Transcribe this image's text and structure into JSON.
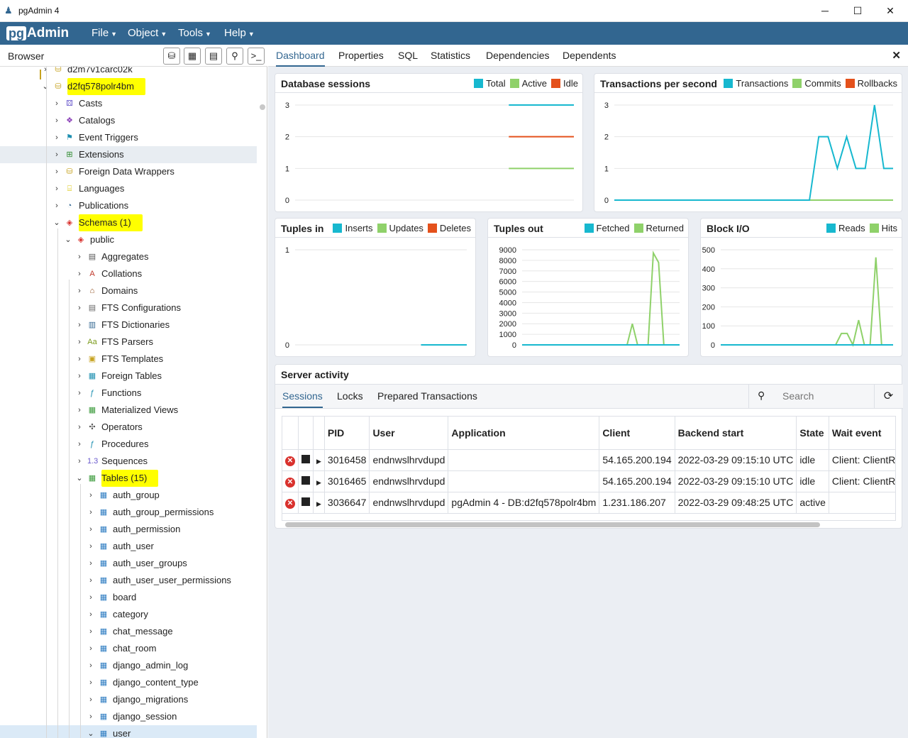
{
  "window": {
    "title": "pgAdmin 4",
    "minimize": "─",
    "maximize": "☐",
    "close": "✕"
  },
  "menubar": {
    "brand_pg": "pg",
    "brand_admin": "Admin",
    "items": [
      "File",
      "Object",
      "Tools",
      "Help"
    ]
  },
  "browser": {
    "label": "Browser",
    "toolbar_icons": [
      "database-icon",
      "grid-icon",
      "filter-table-icon",
      "search-icon",
      "terminal-icon"
    ]
  },
  "tree": [
    {
      "label": "d2m7v1carc02k",
      "depth": 0,
      "chev": "›",
      "icon": "db"
    },
    {
      "label": "d2fq578polr4bm",
      "depth": 0,
      "chev": "⌄",
      "icon": "db",
      "hl": true
    },
    {
      "label": "Casts",
      "depth": 1,
      "chev": "›",
      "icon": "cast"
    },
    {
      "label": "Catalogs",
      "depth": 1,
      "chev": "›",
      "icon": "catalog"
    },
    {
      "label": "Event Triggers",
      "depth": 1,
      "chev": "›",
      "icon": "trigger"
    },
    {
      "label": "Extensions",
      "depth": 1,
      "chev": "›",
      "icon": "ext",
      "sel": true
    },
    {
      "label": "Foreign Data Wrappers",
      "depth": 1,
      "chev": "›",
      "icon": "fdw"
    },
    {
      "label": "Languages",
      "depth": 1,
      "chev": "›",
      "icon": "lang"
    },
    {
      "label": "Publications",
      "depth": 1,
      "chev": "›",
      "icon": "pub"
    },
    {
      "label": "Schemas (1)",
      "depth": 1,
      "chev": "⌄",
      "icon": "schemas",
      "hl": true
    },
    {
      "label": "public",
      "depth": 2,
      "chev": "⌄",
      "icon": "schema"
    },
    {
      "label": "Aggregates",
      "depth": 3,
      "chev": "›",
      "icon": "agg"
    },
    {
      "label": "Collations",
      "depth": 3,
      "chev": "›",
      "icon": "coll"
    },
    {
      "label": "Domains",
      "depth": 3,
      "chev": "›",
      "icon": "domain"
    },
    {
      "label": "FTS Configurations",
      "depth": 3,
      "chev": "›",
      "icon": "fts"
    },
    {
      "label": "FTS Dictionaries",
      "depth": 3,
      "chev": "›",
      "icon": "ftsd"
    },
    {
      "label": "FTS Parsers",
      "depth": 3,
      "chev": "›",
      "icon": "ftsp"
    },
    {
      "label": "FTS Templates",
      "depth": 3,
      "chev": "›",
      "icon": "ftst"
    },
    {
      "label": "Foreign Tables",
      "depth": 3,
      "chev": "›",
      "icon": "ftable"
    },
    {
      "label": "Functions",
      "depth": 3,
      "chev": "›",
      "icon": "func"
    },
    {
      "label": "Materialized Views",
      "depth": 3,
      "chev": "›",
      "icon": "mview"
    },
    {
      "label": "Operators",
      "depth": 3,
      "chev": "›",
      "icon": "oper"
    },
    {
      "label": "Procedures",
      "depth": 3,
      "chev": "›",
      "icon": "proc"
    },
    {
      "label": "Sequences",
      "depth": 3,
      "chev": "›",
      "icon": "seq"
    },
    {
      "label": "Tables (15)",
      "depth": 3,
      "chev": "⌄",
      "icon": "tables",
      "hl": true
    },
    {
      "label": "auth_group",
      "depth": 4,
      "chev": "›",
      "icon": "table"
    },
    {
      "label": "auth_group_permissions",
      "depth": 4,
      "chev": "›",
      "icon": "table"
    },
    {
      "label": "auth_permission",
      "depth": 4,
      "chev": "›",
      "icon": "table"
    },
    {
      "label": "auth_user",
      "depth": 4,
      "chev": "›",
      "icon": "table"
    },
    {
      "label": "auth_user_groups",
      "depth": 4,
      "chev": "›",
      "icon": "table"
    },
    {
      "label": "auth_user_user_permissions",
      "depth": 4,
      "chev": "›",
      "icon": "table"
    },
    {
      "label": "board",
      "depth": 4,
      "chev": "›",
      "icon": "table"
    },
    {
      "label": "category",
      "depth": 4,
      "chev": "›",
      "icon": "table"
    },
    {
      "label": "chat_message",
      "depth": 4,
      "chev": "›",
      "icon": "table"
    },
    {
      "label": "chat_room",
      "depth": 4,
      "chev": "›",
      "icon": "table"
    },
    {
      "label": "django_admin_log",
      "depth": 4,
      "chev": "›",
      "icon": "table"
    },
    {
      "label": "django_content_type",
      "depth": 4,
      "chev": "›",
      "icon": "table"
    },
    {
      "label": "django_migrations",
      "depth": 4,
      "chev": "›",
      "icon": "table"
    },
    {
      "label": "django_session",
      "depth": 4,
      "chev": "›",
      "icon": "table"
    },
    {
      "label": "user",
      "depth": 4,
      "chev": "⌄",
      "icon": "table",
      "sel2": true
    }
  ],
  "tabs": {
    "items": [
      "Dashboard",
      "Properties",
      "SQL",
      "Statistics",
      "Dependencies",
      "Dependents"
    ],
    "active": "Dashboard",
    "close": "✕"
  },
  "colors": {
    "blue": "#17b8cf",
    "green": "#8fd16a",
    "red": "#e4511c",
    "brand": "#326690"
  },
  "chart_data": [
    {
      "type": "line",
      "title": "Database sessions",
      "yticks": [
        "3",
        "2",
        "1",
        "0"
      ],
      "ylim": [
        0,
        3
      ],
      "series": [
        {
          "name": "Total",
          "color": "#17b8cf",
          "x": [
            23,
            30
          ],
          "y": [
            3,
            3
          ]
        },
        {
          "name": "Active",
          "color": "#8fd16a",
          "x": [
            23,
            30
          ],
          "y": [
            1,
            1
          ]
        },
        {
          "name": "Idle",
          "color": "#e4511c",
          "x": [
            23,
            30
          ],
          "y": [
            2,
            2
          ]
        }
      ],
      "xlim": [
        0,
        30
      ]
    },
    {
      "type": "line",
      "title": "Transactions per second",
      "yticks": [
        "3",
        "2",
        "1",
        "0"
      ],
      "ylim": [
        0,
        3
      ],
      "series": [
        {
          "name": "Transactions",
          "color": "#17b8cf",
          "x": [
            0,
            1,
            2,
            3,
            4,
            5,
            6,
            7,
            8,
            9,
            10,
            11,
            12,
            13,
            14,
            15,
            16,
            17,
            18,
            19,
            20,
            21,
            22,
            23,
            24,
            25,
            26,
            27,
            28,
            29,
            30
          ],
          "y": [
            0,
            0,
            0,
            0,
            0,
            0,
            0,
            0,
            0,
            0,
            0,
            0,
            0,
            0,
            0,
            0,
            0,
            0,
            0,
            0,
            0,
            0,
            2,
            2,
            1,
            2,
            1,
            1,
            3,
            1,
            1
          ]
        },
        {
          "name": "Commits",
          "color": "#8fd16a",
          "x": [
            0,
            30
          ],
          "y": [
            0,
            0
          ]
        },
        {
          "name": "Rollbacks",
          "color": "#e4511c",
          "x": [
            0,
            30
          ],
          "y": [
            0,
            0
          ]
        }
      ],
      "xlim": [
        0,
        30
      ]
    },
    {
      "type": "line",
      "title": "Tuples in",
      "yticks": [
        "1",
        "0"
      ],
      "ylim": [
        0,
        1
      ],
      "series": [
        {
          "name": "Inserts",
          "color": "#17b8cf",
          "x": [
            22,
            30
          ],
          "y": [
            0,
            0
          ]
        },
        {
          "name": "Updates",
          "color": "#8fd16a",
          "x": [],
          "y": []
        },
        {
          "name": "Deletes",
          "color": "#e4511c",
          "x": [],
          "y": []
        }
      ],
      "xlim": [
        0,
        30
      ]
    },
    {
      "type": "line",
      "title": "Tuples out",
      "yticks": [
        "9000",
        "8000",
        "7000",
        "6000",
        "5000",
        "4000",
        "3000",
        "2000",
        "1000",
        "0"
      ],
      "ylim": [
        0,
        9000
      ],
      "series": [
        {
          "name": "Fetched",
          "color": "#17b8cf",
          "x": [
            0,
            30
          ],
          "y": [
            0,
            0
          ]
        },
        {
          "name": "Returned",
          "color": "#8fd16a",
          "x": [
            0,
            10,
            11,
            12,
            20,
            21,
            22,
            23,
            24,
            25,
            26,
            27,
            28,
            29,
            30
          ],
          "y": [
            0,
            0,
            0,
            0,
            0,
            2000,
            0,
            0,
            0,
            8700,
            7800,
            0,
            0,
            0,
            0
          ]
        }
      ],
      "xlim": [
        0,
        30
      ]
    },
    {
      "type": "line",
      "title": "Block I/O",
      "yticks": [
        "500",
        "400",
        "300",
        "200",
        "100",
        "0"
      ],
      "ylim": [
        0,
        500
      ],
      "series": [
        {
          "name": "Reads",
          "color": "#17b8cf",
          "x": [
            0,
            30
          ],
          "y": [
            0,
            0
          ]
        },
        {
          "name": "Hits",
          "color": "#8fd16a",
          "x": [
            0,
            20,
            21,
            22,
            23,
            24,
            25,
            26,
            27,
            28,
            29,
            30
          ],
          "y": [
            0,
            0,
            60,
            60,
            0,
            130,
            0,
            0,
            460,
            0,
            0,
            0
          ]
        }
      ],
      "xlim": [
        0,
        30
      ]
    }
  ],
  "activity": {
    "title": "Server activity",
    "subtabs": [
      "Sessions",
      "Locks",
      "Prepared Transactions"
    ],
    "search_placeholder": "Search",
    "columns": [
      "PID",
      "User",
      "Application",
      "Client",
      "Backend start",
      "State",
      "Wait event"
    ],
    "rows": [
      {
        "pid": "3016458",
        "user": "endnwslhrvdupd",
        "app": "",
        "client": "54.165.200.194",
        "start": "2022-03-29 09:15:10 UTC",
        "state": "idle",
        "wait": "Client: ClientRe"
      },
      {
        "pid": "3016465",
        "user": "endnwslhrvdupd",
        "app": "",
        "client": "54.165.200.194",
        "start": "2022-03-29 09:15:10 UTC",
        "state": "idle",
        "wait": "Client: ClientRe"
      },
      {
        "pid": "3036647",
        "user": "endnwslhrvdupd",
        "app": "pgAdmin 4 - DB:d2fq578polr4bm",
        "client": "1.231.186.207",
        "start": "2022-03-29 09:48:25 UTC",
        "state": "active",
        "wait": ""
      }
    ]
  }
}
